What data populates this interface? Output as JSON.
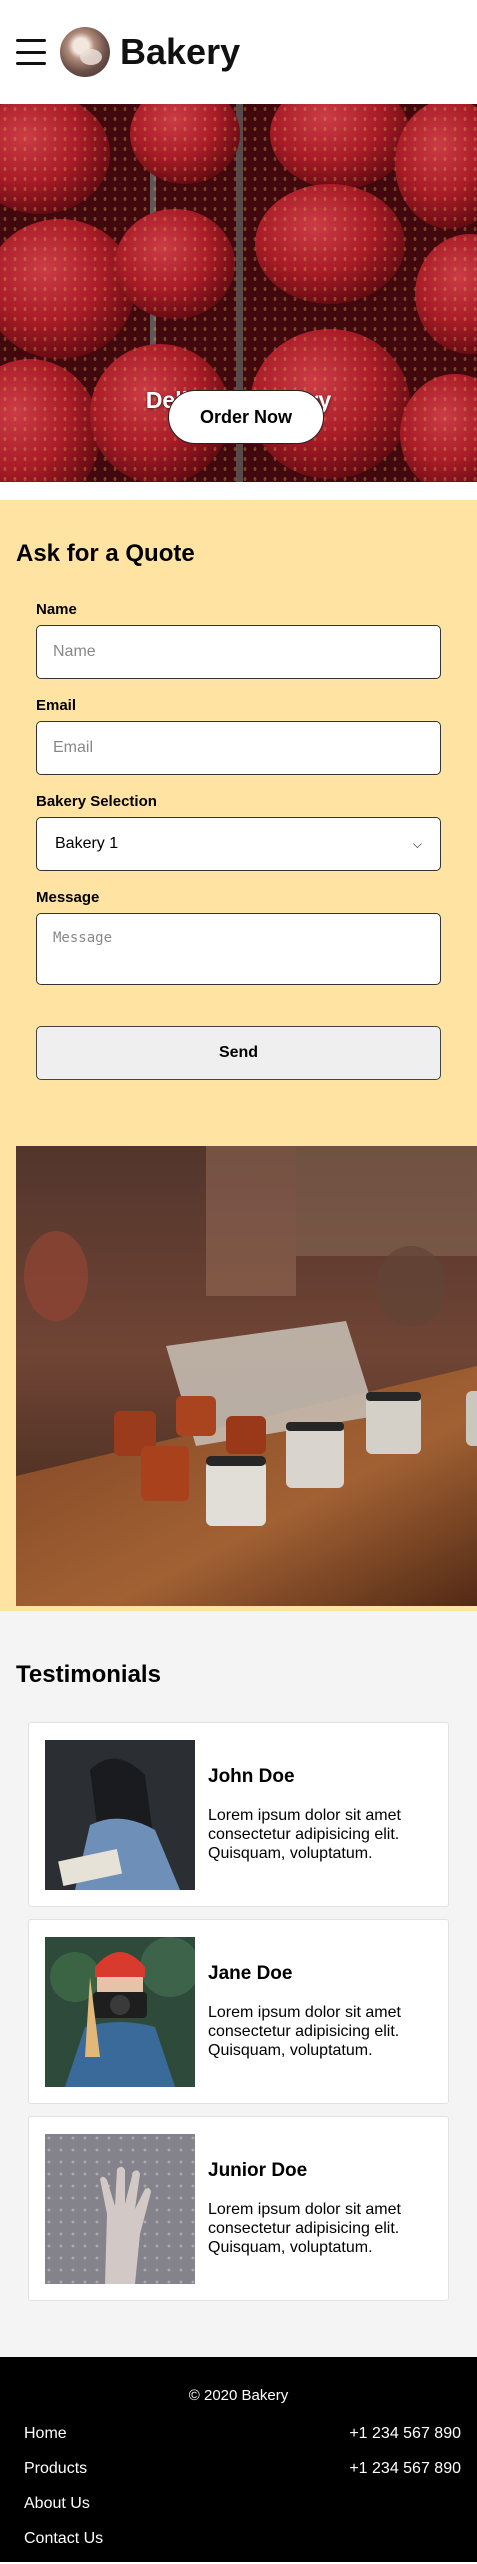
{
  "header": {
    "brand": "Bakery",
    "icons": {
      "menu": "hamburger-menu-icon",
      "avatar": "avatar-image"
    }
  },
  "hero": {
    "title": "Delicious Bakery",
    "button": "Order Now",
    "image": "strawberries-photo"
  },
  "quote": {
    "heading": "Ask for a Quote",
    "name_label": "Name",
    "name_placeholder": "Name",
    "email_label": "Email",
    "email_placeholder": "Email",
    "selection_label": "Bakery Selection",
    "selection_value": "Bakery 1",
    "message_label": "Message",
    "message_placeholder": "Message",
    "send": "Send",
    "image": "cafe-cups-photo"
  },
  "testimonials": {
    "heading": "Testimonials",
    "items": [
      {
        "name": "John Doe",
        "text": "Lorem ipsum dolor sit amet consectetur adipisicing elit. Quisquam, voluptatum.",
        "image": "woman-reading-photo"
      },
      {
        "name": "Jane Doe",
        "text": "Lorem ipsum dolor sit amet consectetur adipisicing elit. Quisquam, voluptatum.",
        "image": "woman-camera-photo"
      },
      {
        "name": "Junior Doe",
        "text": "Lorem ipsum dolor sit amet consectetur adipisicing elit. Quisquam, voluptatum.",
        "image": "hand-on-glass-photo"
      }
    ]
  },
  "footer": {
    "copyright": "© 2020 Bakery",
    "links": [
      "Home",
      "Products",
      "About Us",
      "Contact Us"
    ],
    "phones": [
      "+1 234 567 890",
      "+1 234 567 890"
    ]
  },
  "colors": {
    "quote_bg": "#ffe3a3",
    "testimonials_bg": "#f4f4f4",
    "footer_bg": "#000000"
  }
}
